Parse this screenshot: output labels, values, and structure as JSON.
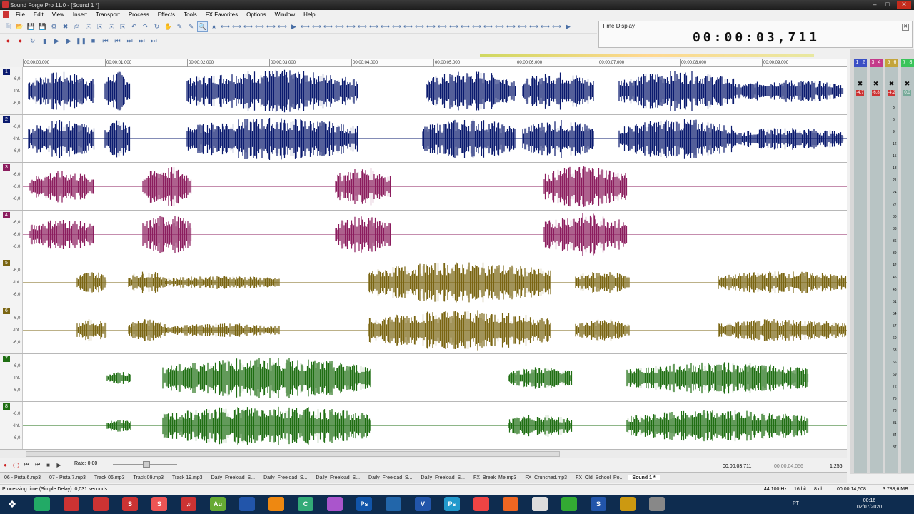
{
  "window": {
    "title": "Sound Forge Pro 11.0 - [Sound 1 *]"
  },
  "menu": [
    "File",
    "Edit",
    "View",
    "Insert",
    "Transport",
    "Process",
    "Effects",
    "Tools",
    "FX Favorites",
    "Options",
    "Window",
    "Help"
  ],
  "time_display": {
    "label": "Time Display",
    "value": "00:00:03,711"
  },
  "ruler": {
    "ticks": [
      "00:00:00,000",
      "00:00:01,000",
      "00:00:02,000",
      "00:00:03,000",
      "00:00:04,000",
      "00:00:05,000",
      "00:00:06,000",
      "00:00:07,000",
      "00:00:08,000",
      "00:00:09,000"
    ]
  },
  "tracks": [
    {
      "num": "1",
      "color": "#0a1a6e",
      "db": [
        "-6,0",
        "-Inf.",
        "-6,0"
      ]
    },
    {
      "num": "2",
      "color": "#0a1a6e",
      "db": [
        "-6,0",
        "-Inf.",
        "-6,0"
      ]
    },
    {
      "num": "3",
      "color": "#8b1d5e",
      "db": [
        "-6,0",
        "-6,0",
        "-6,0"
      ]
    },
    {
      "num": "4",
      "color": "#8b1d5e",
      "db": [
        "-6,0",
        "-6,0",
        "-6,0"
      ]
    },
    {
      "num": "5",
      "color": "#7a6512",
      "db": [
        "-6,0",
        "-Inf.",
        "-6,0"
      ]
    },
    {
      "num": "6",
      "color": "#7a6512",
      "db": [
        "-6,0",
        "-Inf.",
        "-6,0"
      ]
    },
    {
      "num": "7",
      "color": "#1f6e12",
      "db": [
        "-6,0",
        "-Inf.",
        "-6,0"
      ]
    },
    {
      "num": "8",
      "color": "#1f6e12",
      "db": [
        "-6,0",
        "-Inf.",
        "-6,0"
      ]
    }
  ],
  "transport": {
    "rate": "Rate: 0,00",
    "position": "00:00:03,711",
    "length": "00:00:04,056",
    "zoom": "1:256"
  },
  "meters": {
    "peaks": [
      "-4,7",
      "-6,8",
      "-4,2",
      "0,0"
    ],
    "scale": [
      "3",
      "6",
      "9",
      "12",
      "15",
      "18",
      "21",
      "24",
      "27",
      "30",
      "33",
      "36",
      "39",
      "42",
      "45",
      "48",
      "51",
      "54",
      "57",
      "60",
      "63",
      "66",
      "69",
      "72",
      "75",
      "78",
      "81",
      "84",
      "87"
    ]
  },
  "tabs": [
    "06 - Pista 6.mp3",
    "07 - Pista 7.mp3",
    "Track 06.mp3",
    "Track 09.mp3",
    "Track 19.mp3",
    "Daily_Freeload_S...",
    "Daily_Freeload_S...",
    "Daily_Freeload_S...",
    "Daily_Freeload_S...",
    "Daily_Freeload_S...",
    "FX_Break_Me.mp3",
    "FX_Crunched.mp3",
    "FX_Old_School_Po...",
    "Sound 1 *"
  ],
  "status": {
    "text": "Processing time (Simple Delay): 0,031 seconds",
    "rate": "44.100 Hz",
    "bits": "16 bit",
    "ch": "8 ch.",
    "len": "00:00:14,508",
    "size": "3.783,6 MB"
  },
  "taskbar": {
    "lang": "PT",
    "time": "00:16",
    "date": "02/07/2020"
  }
}
